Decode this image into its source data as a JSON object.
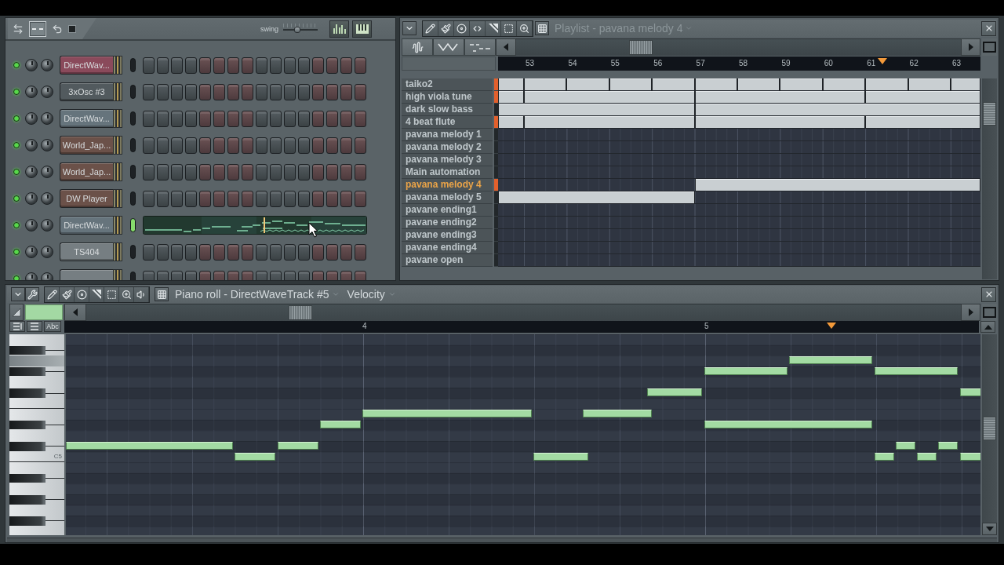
{
  "channel_rack": {
    "swing": {
      "label": "swing",
      "level": 0.4
    },
    "channels": [
      {
        "name": "DirectWav...",
        "color": "#8a4a5b",
        "enabled": true,
        "selected": false,
        "kind": "steps"
      },
      {
        "name": "3xOsc #3",
        "color": "#525a5e",
        "enabled": true,
        "selected": false,
        "kind": "steps"
      },
      {
        "name": "DirectWav...",
        "color": "#66747c",
        "enabled": true,
        "selected": false,
        "kind": "steps"
      },
      {
        "name": "World_Jap...",
        "color": "#6b5149",
        "enabled": true,
        "selected": false,
        "kind": "steps"
      },
      {
        "name": "World_Jap...",
        "color": "#6b5149",
        "enabled": true,
        "selected": false,
        "kind": "steps"
      },
      {
        "name": "DW Player",
        "color": "#6b5149",
        "enabled": true,
        "selected": false,
        "kind": "steps"
      },
      {
        "name": "DirectWav...",
        "color": "#66747c",
        "enabled": true,
        "selected": true,
        "kind": "preview"
      },
      {
        "name": "TS404",
        "color": "#767e82",
        "enabled": true,
        "selected": false,
        "kind": "steps"
      },
      {
        "color": "#767e82",
        "enabled": true,
        "selected": false,
        "kind": "steps"
      }
    ]
  },
  "playlist": {
    "title": "Playlist - pavana melody 4",
    "bar_numbers": [
      "53",
      "54",
      "55",
      "56",
      "57",
      "58",
      "59",
      "60",
      "61",
      "62",
      "63"
    ],
    "tracks": [
      {
        "name": "taiko2",
        "marker_lit": true,
        "selected": false
      },
      {
        "name": "high viola tune",
        "marker_lit": true,
        "selected": false
      },
      {
        "name": "dark slow bass",
        "marker_lit": false,
        "selected": false
      },
      {
        "name": "4 beat flute",
        "marker_lit": true,
        "selected": false
      },
      {
        "name": "pavana melody 1",
        "marker_lit": false,
        "selected": false
      },
      {
        "name": "pavana melody 2",
        "marker_lit": false,
        "selected": false
      },
      {
        "name": "pavana melody 3",
        "marker_lit": false,
        "selected": false
      },
      {
        "name": "Main automation",
        "marker_lit": false,
        "selected": false
      },
      {
        "name": "pavana melody 4",
        "marker_lit": true,
        "selected": true
      },
      {
        "name": "pavana melody 5",
        "marker_lit": false,
        "selected": false
      },
      {
        "name": "pavane ending1",
        "marker_lit": false,
        "selected": false
      },
      {
        "name": "pavane ending2",
        "marker_lit": false,
        "selected": false
      },
      {
        "name": "pavane ending3",
        "marker_lit": false,
        "selected": false
      },
      {
        "name": "pavane ending4",
        "marker_lit": false,
        "selected": false
      },
      {
        "name": "pavane open",
        "marker_lit": false,
        "selected": false
      }
    ]
  },
  "piano_roll": {
    "title": "Piano roll - DirectWaveTrack #5",
    "view_menu": "Velocity",
    "label_button": "Abc",
    "bar_numbers": [
      "4",
      "5"
    ],
    "keys": [
      {
        "kind": "white",
        "pressed": false
      },
      {
        "kind": "black",
        "pressed": false
      },
      {
        "kind": "white",
        "pressed": true
      },
      {
        "kind": "black",
        "pressed": false
      },
      {
        "kind": "white",
        "pressed": false
      },
      {
        "kind": "black",
        "pressed": false
      },
      {
        "kind": "white",
        "pressed": false
      },
      {
        "kind": "white",
        "pressed": false
      },
      {
        "kind": "black",
        "pressed": false
      },
      {
        "kind": "white",
        "pressed": false
      },
      {
        "kind": "black",
        "pressed": false
      },
      {
        "kind": "white",
        "pressed": false,
        "label": "C5"
      },
      {
        "kind": "white",
        "pressed": false
      },
      {
        "kind": "black",
        "pressed": false
      },
      {
        "kind": "white",
        "pressed": false
      },
      {
        "kind": "black",
        "pressed": false
      },
      {
        "kind": "white",
        "pressed": false
      },
      {
        "kind": "black",
        "pressed": false
      },
      {
        "kind": "white",
        "pressed": false
      }
    ]
  }
}
